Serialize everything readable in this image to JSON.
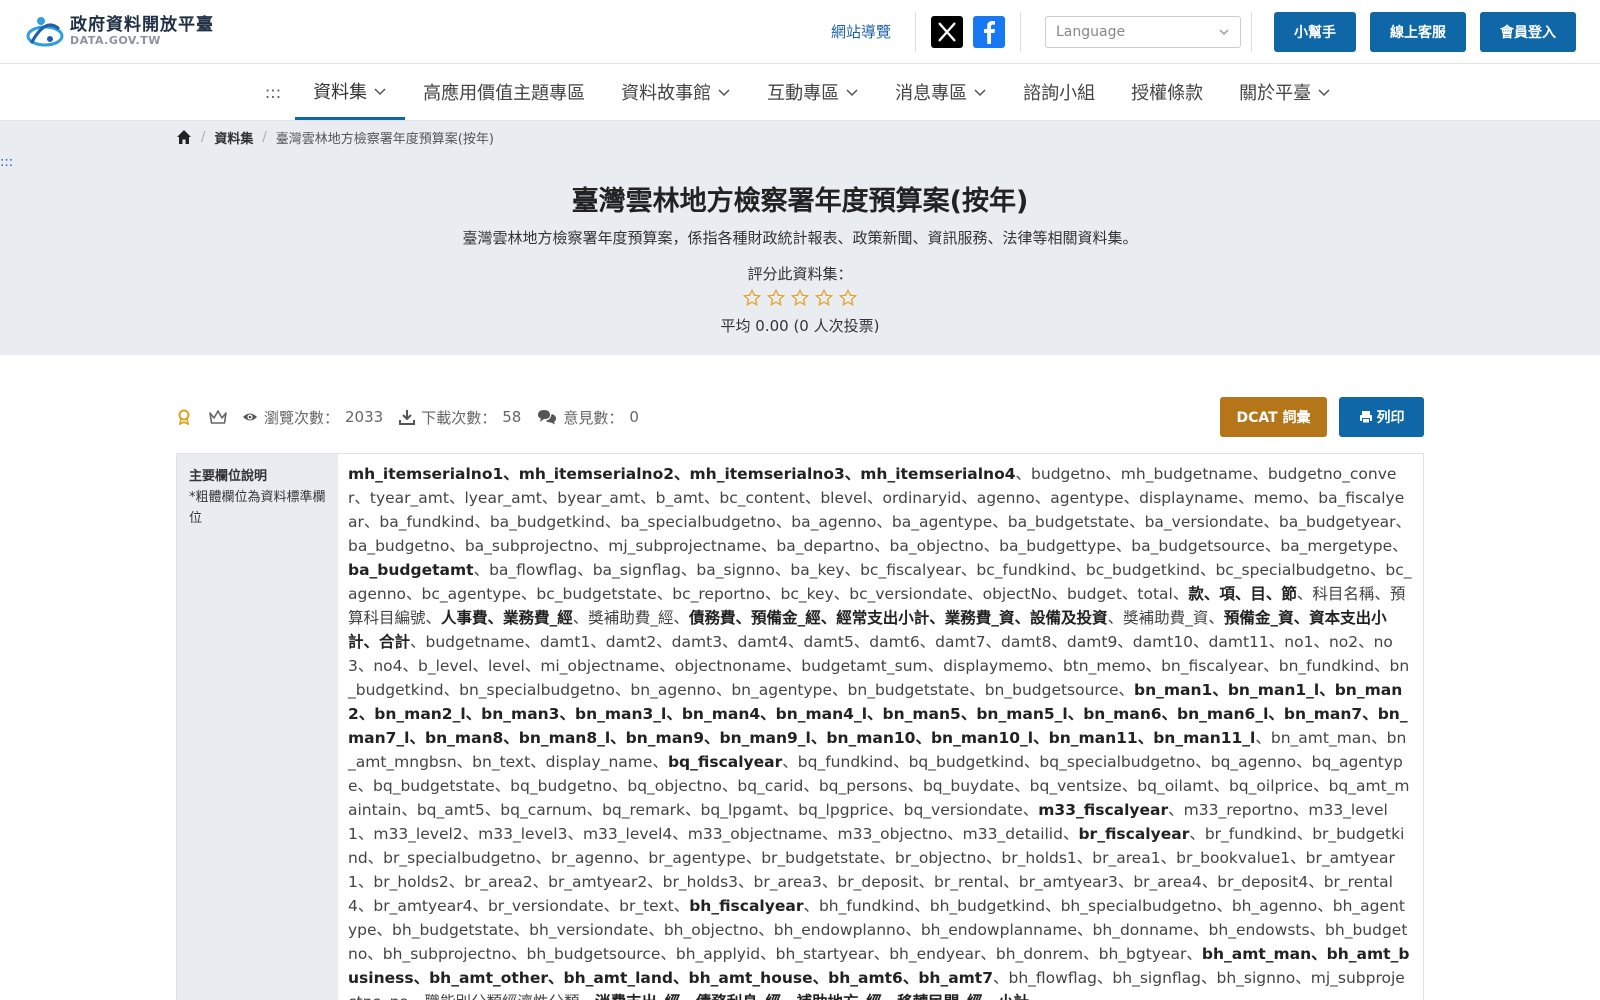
{
  "header": {
    "logo_cn": "政府資料開放平臺",
    "logo_en": "DATA.GOV.TW",
    "sitemap": "網站導覽",
    "language_placeholder": "Language",
    "helper": "小幫手",
    "online_service": "線上客服",
    "member_login": "會員登入"
  },
  "nav": {
    "access_key": ":::",
    "items": [
      {
        "label": "資料集",
        "dropdown": true,
        "active": true
      },
      {
        "label": "高應用價值主題專區",
        "dropdown": false
      },
      {
        "label": "資料故事館",
        "dropdown": true
      },
      {
        "label": "互動專區",
        "dropdown": true
      },
      {
        "label": "消息專區",
        "dropdown": true
      },
      {
        "label": "諮詢小組",
        "dropdown": false
      },
      {
        "label": "授權條款",
        "dropdown": false
      },
      {
        "label": "關於平臺",
        "dropdown": true
      }
    ]
  },
  "breadcrumb": {
    "level1": "資料集",
    "current": "臺灣雲林地方檢察署年度預算案(按年)"
  },
  "hero": {
    "access_key": ":::",
    "title": "臺灣雲林地方檢察署年度預算案(按年)",
    "description": "臺灣雲林地方檢察署年度預算案，係指各種財政統計報表、政策新聞、資訊服務、法律等相關資料集。",
    "rate_label": "評分此資料集：",
    "rating": 0,
    "average": "平均 0.00 (0 人次投票)"
  },
  "stats": {
    "views_label": "瀏覽次數：",
    "views": "2033",
    "downloads_label": "下載次數：",
    "downloads": "58",
    "comments_label": "意見數：",
    "comments": "0",
    "dcat_button": "DCAT 詞彙",
    "print_button": "列印"
  },
  "fields_table": {
    "label_title": "主要欄位說明",
    "label_note": "*粗體欄位為資料標準欄位",
    "segments": [
      {
        "t": "mh_itemserialno1、mh_itemserialno2、mh_itemserialno3、mh_itemserialno4",
        "b": true
      },
      {
        "t": "、budgetno、mh_budgetname、budgetno_conver、tyear_amt、lyear_amt、byear_amt、b_amt、bc_content、blevel、ordinaryid、agenno、agentype、displayname、memo、ba_fiscalyear、ba_fundkind、ba_budgetkind、ba_specialbudgetno、ba_agenno、ba_agentype、ba_budgetstate、ba_versiondate、ba_budgetyear、ba_budgetno、ba_subprojectno、mj_subprojectname、ba_departno、ba_objectno、ba_budgettype、ba_budgetsource、ba_mergetype、",
        "b": false
      },
      {
        "t": "ba_budgetamt",
        "b": true
      },
      {
        "t": "、ba_flowflag、ba_signflag、ba_signno、ba_key、bc_fiscalyear、bc_fundkind、bc_budgetkind、bc_specialbudgetno、bc_agenno、bc_agentype、bc_budgetstate、bc_reportno、bc_key、bc_versiondate、objectNo、budget、total、",
        "b": false
      },
      {
        "t": "款、項、目、節",
        "b": true
      },
      {
        "t": "、科目名稱、預算科目編號、",
        "b": false
      },
      {
        "t": "人事費、業務費_經",
        "b": true
      },
      {
        "t": "、獎補助費_經、",
        "b": false
      },
      {
        "t": "債務費、預備金_經、經常支出小計、業務費_資、設備及投資",
        "b": true
      },
      {
        "t": "、獎補助費_資、",
        "b": false
      },
      {
        "t": "預備金_資、資本支出小計、合計",
        "b": true
      },
      {
        "t": "、budgetname、damt1、damt2、damt3、damt4、damt5、damt6、damt7、damt8、damt9、damt10、damt11、no1、no2、no3、no4、b_level、level、mi_objectname、objectnoname、budgetamt_sum、displaymemo、btn_memo、bn_fiscalyear、bn_fundkind、bn_budgetkind、bn_specialbudgetno、bn_agenno、bn_agentype、bn_budgetstate、bn_budgetsource、",
        "b": false
      },
      {
        "t": "bn_man1、bn_man1_l、bn_man2、bn_man2_l、bn_man3、bn_man3_l、bn_man4、bn_man4_l、bn_man5、bn_man5_l、bn_man6、bn_man6_l、bn_man7、bn_man7_l、bn_man8、bn_man8_l、bn_man9、bn_man9_l、bn_man10、bn_man10_l、bn_man11、bn_man11_l",
        "b": true
      },
      {
        "t": "、bn_amt_man、bn_amt_mngbsn、bn_text、display_name、",
        "b": false
      },
      {
        "t": "bq_fiscalyear",
        "b": true
      },
      {
        "t": "、bq_fundkind、bq_budgetkind、bq_specialbudgetno、bq_agenno、bq_agentype、bq_budgetstate、bq_budgetno、bq_objectno、bq_carid、bq_persons、bq_buydate、bq_ventsize、bq_oilamt、bq_oilprice、bq_amt_maintain、bq_amt5、bq_carnum、bq_remark、bq_lpgamt、bq_lpgprice、bq_versiondate、",
        "b": false
      },
      {
        "t": "m33_fiscalyear",
        "b": true
      },
      {
        "t": "、m33_reportno、m33_level1、m33_level2、m33_level3、m33_level4、m33_objectname、m33_objectno、m33_detailid、",
        "b": false
      },
      {
        "t": "br_fiscalyear",
        "b": true
      },
      {
        "t": "、br_fundkind、br_budgetkind、br_specialbudgetno、br_agenno、br_agentype、br_budgetstate、br_objectno、br_holds1、br_area1、br_bookvalue1、br_amtyear1、br_holds2、br_area2、br_amtyear2、br_holds3、br_area3、br_deposit、br_rental、br_amtyear3、br_area4、br_deposit4、br_rental4、br_amtyear4、br_versiondate、br_text、",
        "b": false
      },
      {
        "t": "bh_fiscalyear",
        "b": true
      },
      {
        "t": "、bh_fundkind、bh_budgetkind、bh_specialbudgetno、bh_agenno、bh_agentype、bh_budgetstate、bh_versiondate、bh_objectno、bh_endowplanno、bh_endowplanname、bh_donname、bh_endowsts、bh_budgetno、bh_subprojectno、bh_budgetsource、bh_applyid、bh_startyear、bh_endyear、bh_donrem、bh_bgtyear、",
        "b": false
      },
      {
        "t": "bh_amt_man、bh_amt_business、bh_amt_other、bh_amt_land、bh_amt_house、bh_amt6、bh_amt7",
        "b": true
      },
      {
        "t": "、bh_flowflag、bh_signflag、bh_signno、mj_subprojectno_na、職能別分類經濟性分類、",
        "b": false
      },
      {
        "t": "消費支出_經、債務利息_經、補助地方_經、移轉民間_經、小計",
        "b": true
      }
    ]
  },
  "colors": {
    "primary_blue": "#0f67a7",
    "dcat_gold": "#b5761a",
    "hero_bg": "#e9edf2",
    "star_gold": "#e0a325"
  }
}
